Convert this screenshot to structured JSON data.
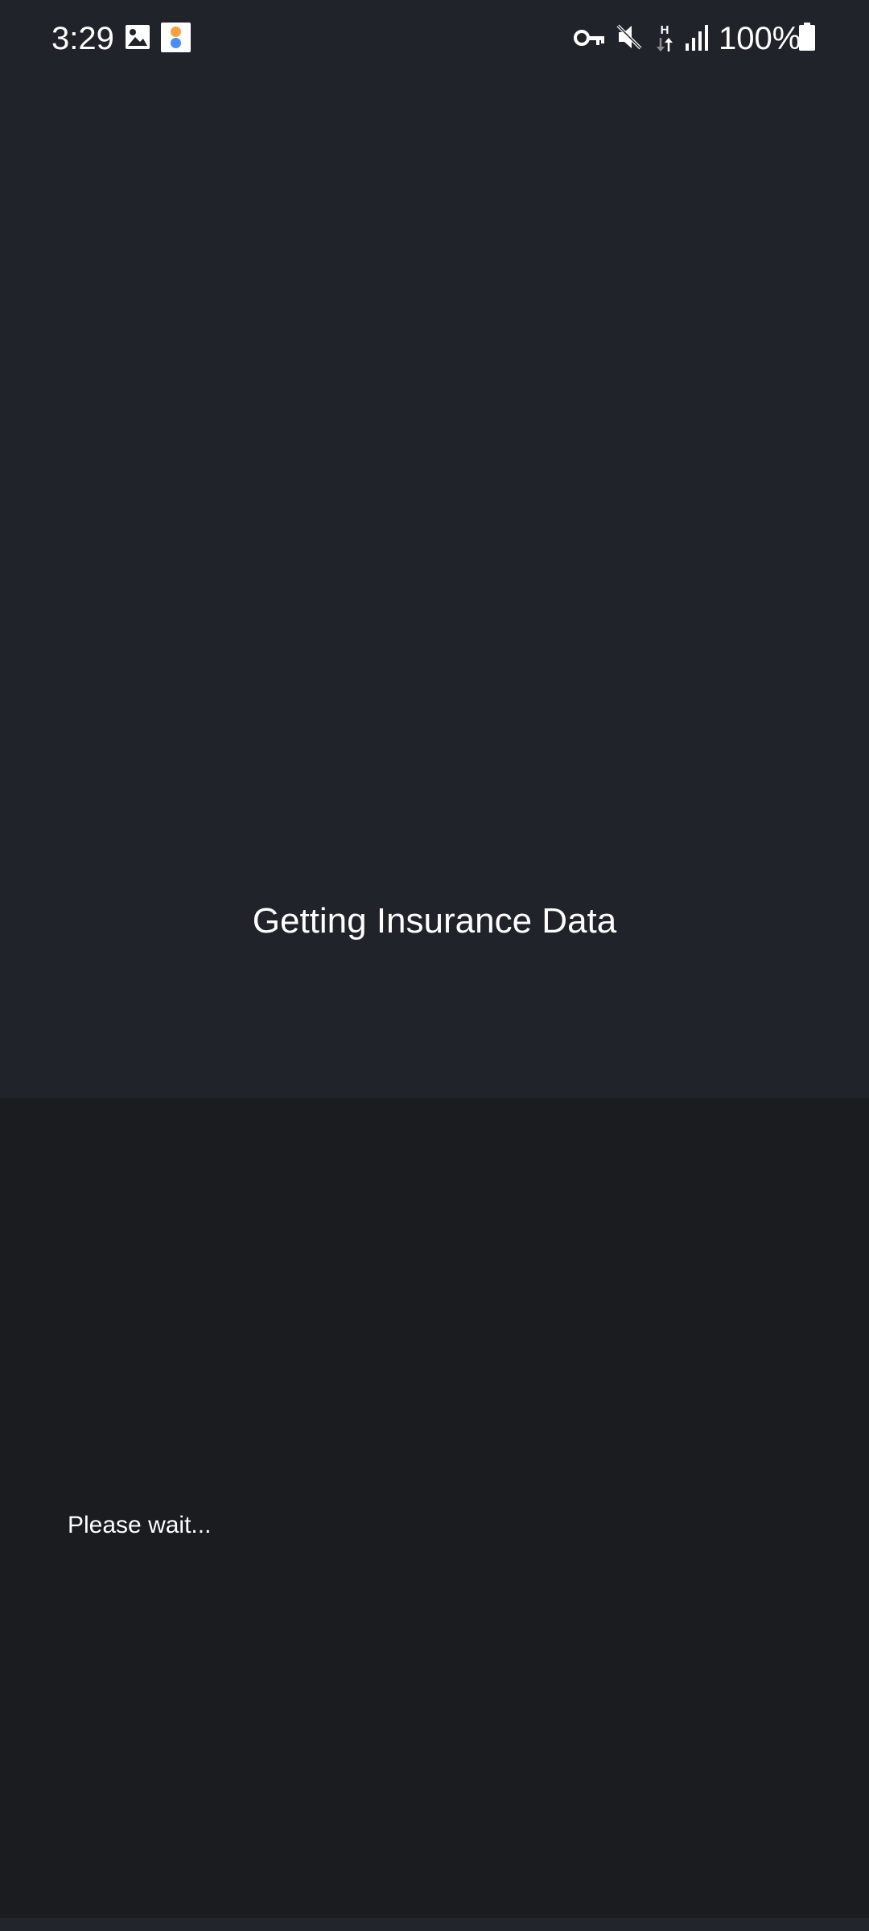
{
  "status_bar": {
    "time": "3:29",
    "battery_percent": "100%",
    "notification_icons": [
      "gallery-icon",
      "app-notification-icon"
    ],
    "system_icons": [
      "vpn-key-icon",
      "mute-icon",
      "network-h-icon",
      "signal-icon",
      "battery-icon"
    ]
  },
  "main": {
    "title": "Getting Insurance Data"
  },
  "dialog": {
    "message": "Please wait..."
  },
  "colors": {
    "top_background": "#20232a",
    "bottom_background": "#1a1c20",
    "text": "#ffffff"
  }
}
